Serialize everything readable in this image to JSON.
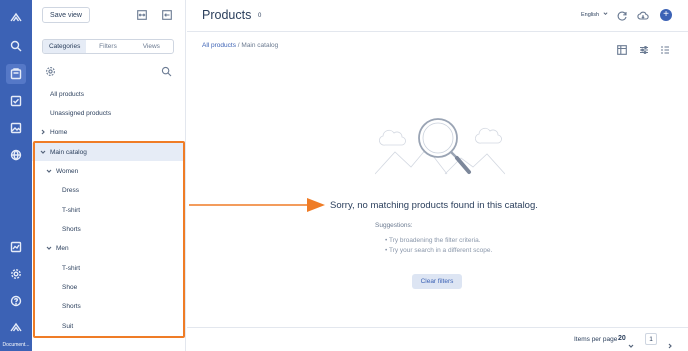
{
  "rail": {
    "label": "Document..."
  },
  "sidebar": {
    "save_view": "Save view",
    "tabs": [
      {
        "label": "Categories"
      },
      {
        "label": "Filters"
      },
      {
        "label": "Views"
      }
    ],
    "tree": [
      {
        "label": "All products"
      },
      {
        "label": "Unassigned products"
      },
      {
        "label": "Home"
      },
      {
        "label": "Main catalog"
      },
      {
        "label": "Women"
      },
      {
        "label": "Dress"
      },
      {
        "label": "T-shirt"
      },
      {
        "label": "Shorts"
      },
      {
        "label": "Men"
      },
      {
        "label": "T-shirt"
      },
      {
        "label": "Shoe"
      },
      {
        "label": "Shorts"
      },
      {
        "label": "Suit"
      }
    ]
  },
  "header": {
    "title": "Products",
    "count": "0",
    "language": "English"
  },
  "breadcrumb": {
    "root": "All products",
    "separator": "/",
    "current": "Main catalog"
  },
  "empty_state": {
    "title": "Sorry, no matching products found in this catalog.",
    "suggestions_title": "Suggestions:",
    "suggestions": [
      "Try broadening the filter criteria.",
      "Try your search in a different scope."
    ],
    "clear_button": "Clear filters"
  },
  "footer": {
    "items_per_page_label": "Items per page",
    "items_per_page_value": "20",
    "page": "1"
  },
  "colors": {
    "rail": "#3c62b5",
    "accent": "#3c62b5",
    "annotation": "#ef7c26",
    "selected_row": "#e6ecf6"
  }
}
